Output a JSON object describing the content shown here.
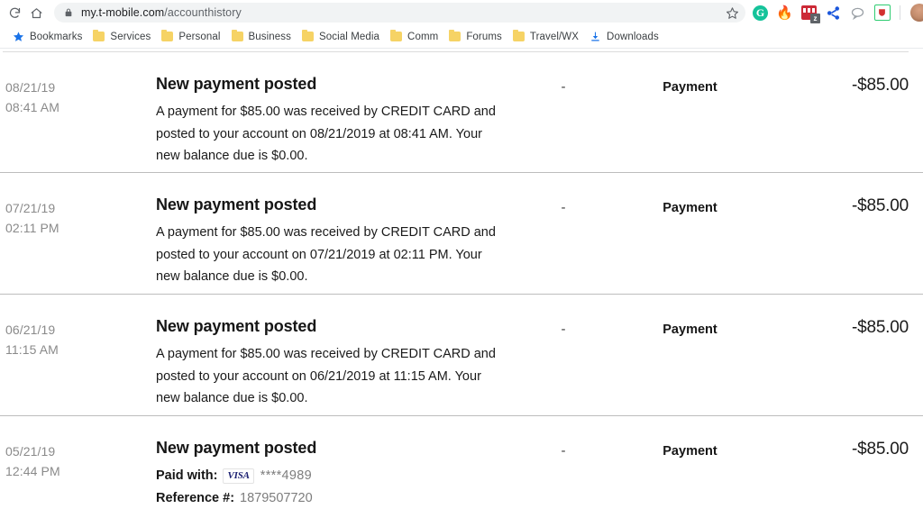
{
  "browser": {
    "reload_tooltip": "Reload",
    "home_tooltip": "Home",
    "url_host": "my.t-mobile.com",
    "url_path": "/accounthistory",
    "lock_icon": "lock-icon",
    "star_icon": "bookmark-star-icon",
    "extensions": [
      {
        "name": "grammarly-extension-icon",
        "glyph": "G",
        "color": "#15c39a"
      },
      {
        "name": "flame-extension-icon",
        "glyph": "🔥",
        "color": "#ef6c00"
      },
      {
        "name": "zotero-connector-extension-icon",
        "glyph": "z",
        "color": "#cc2936"
      },
      {
        "name": "share-extension-icon",
        "glyph": "",
        "color": "#1a56db"
      },
      {
        "name": "speech-bubble-extension-icon",
        "glyph": "",
        "color": "#9aa0a6"
      },
      {
        "name": "pocket-extension-icon",
        "glyph": "",
        "color": "#2ecc71"
      }
    ],
    "avatar_label": "profile-avatar"
  },
  "bookmarks": {
    "items": [
      {
        "label": "Bookmarks",
        "icon": "star-icon"
      },
      {
        "label": "Services",
        "icon": "folder-icon"
      },
      {
        "label": "Personal",
        "icon": "folder-icon"
      },
      {
        "label": "Business",
        "icon": "folder-icon"
      },
      {
        "label": "Social Media",
        "icon": "folder-icon"
      },
      {
        "label": "Comm",
        "icon": "folder-icon"
      },
      {
        "label": "Forums",
        "icon": "folder-icon"
      },
      {
        "label": "Travel/WX",
        "icon": "folder-icon"
      },
      {
        "label": "Downloads",
        "icon": "download-icon"
      }
    ]
  },
  "account_history": {
    "transactions": [
      {
        "date": "08/21/19",
        "time": "08:41 AM",
        "title": "New payment posted",
        "body": "A payment for $85.00 was received by CREDIT CARD and posted to your account on 08/21/2019 at 08:41 AM. Your new balance due is $0.00.",
        "dash": "-",
        "type": "Payment",
        "amount": "-$85.00"
      },
      {
        "date": "07/21/19",
        "time": "02:11 PM",
        "title": "New payment posted",
        "body": "A payment for $85.00 was received by CREDIT CARD and posted to your account on 07/21/2019 at 02:11 PM. Your new balance due is $0.00.",
        "dash": "-",
        "type": "Payment",
        "amount": "-$85.00"
      },
      {
        "date": "06/21/19",
        "time": "11:15 AM",
        "title": "New payment posted",
        "body": "A payment for $85.00 was received by CREDIT CARD and posted to your account on 06/21/2019 at 11:15 AM. Your new balance due is $0.00.",
        "dash": "-",
        "type": "Payment",
        "amount": "-$85.00"
      },
      {
        "date": "05/21/19",
        "time": "12:44 PM",
        "title": "New payment posted",
        "paid_with_label": "Paid with:",
        "card_brand": "VISA",
        "card_mask": "****4989",
        "reference_label": "Reference #:",
        "reference_value": "1879507720",
        "dash": "-",
        "type": "Payment",
        "amount": "-$85.00"
      }
    ]
  }
}
